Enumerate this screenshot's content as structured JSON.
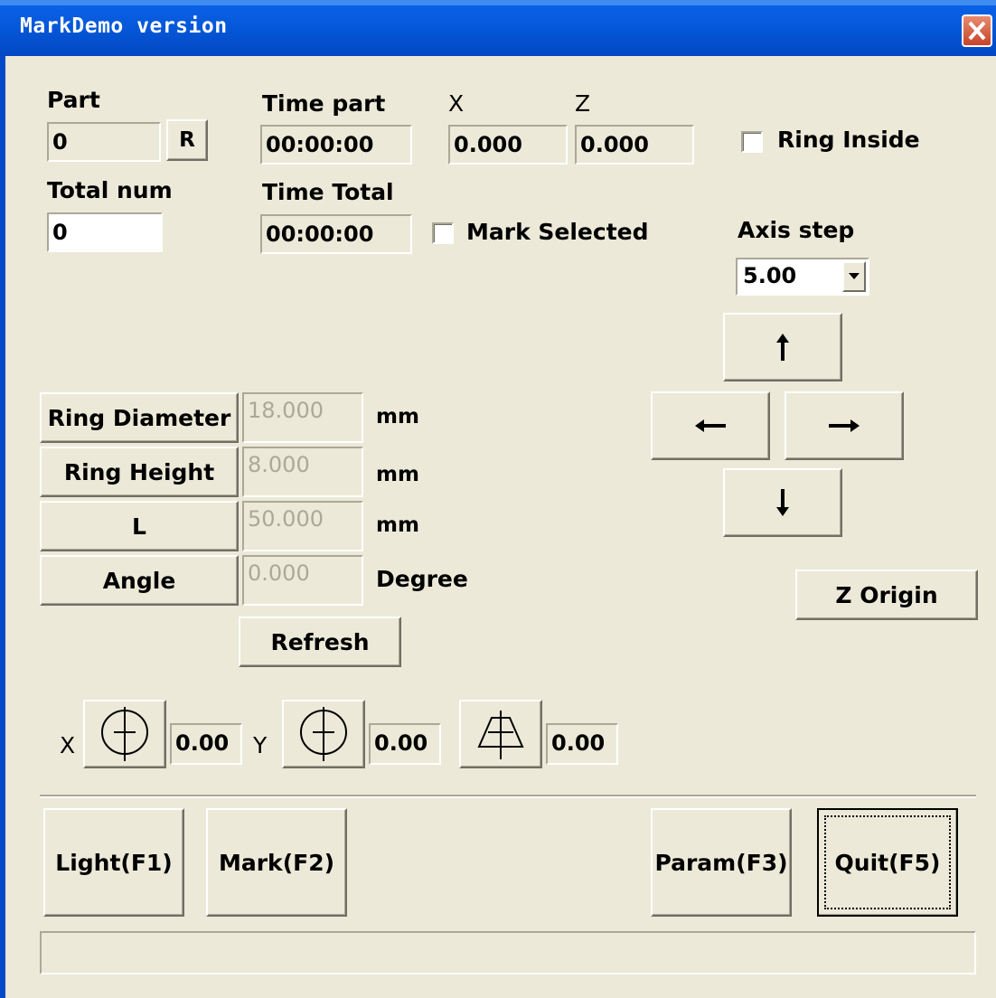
{
  "window": {
    "title": "MarkDemo version"
  },
  "part": {
    "label": "Part",
    "value": "0",
    "reset_label": "R"
  },
  "total": {
    "label": "Total num",
    "value": "0"
  },
  "time_part": {
    "label": "Time part",
    "value": "00:00:00"
  },
  "time_total": {
    "label": "Time Total",
    "value": "00:00:00"
  },
  "x_pos": {
    "label": "X",
    "value": "0.000"
  },
  "z_pos": {
    "label": "Z",
    "value": "0.000"
  },
  "ring_inside": {
    "label": "Ring Inside",
    "checked": false
  },
  "mark_selected": {
    "label": "Mark Selected",
    "checked": false
  },
  "axis_step": {
    "label": "Axis step",
    "value": "5.00"
  },
  "params": [
    {
      "label": "Ring Diameter",
      "value": "18.000",
      "unit": "mm"
    },
    {
      "label": "Ring Height",
      "value": "8.000",
      "unit": "mm"
    },
    {
      "label": "L",
      "value": "50.000",
      "unit": "mm"
    },
    {
      "label": "Angle",
      "value": "0.000",
      "unit": "Degree"
    }
  ],
  "refresh_label": "Refresh",
  "z_origin_label": "Z Origin",
  "offsets": {
    "x_label": "X",
    "x_value": "0.00",
    "y_label": "Y",
    "y_value": "0.00",
    "t_value": "0.00"
  },
  "footer": {
    "light": "Light(F1)",
    "mark": "Mark(F2)",
    "param": "Param(F3)",
    "quit": "Quit(F5)"
  },
  "colors": {
    "titlebar": "#0457d8",
    "face": "#ece9d8",
    "close": "#c6452a"
  },
  "icons": {
    "up": "arrow-up-icon",
    "down": "arrow-down-icon",
    "left": "arrow-left-icon",
    "right": "arrow-right-icon",
    "x_mirror": "circle-cross-icon",
    "y_mirror": "circle-cross-icon",
    "trapezoid": "trapezoid-cross-icon",
    "close": "close-icon",
    "dropdown": "chevron-down-icon"
  }
}
